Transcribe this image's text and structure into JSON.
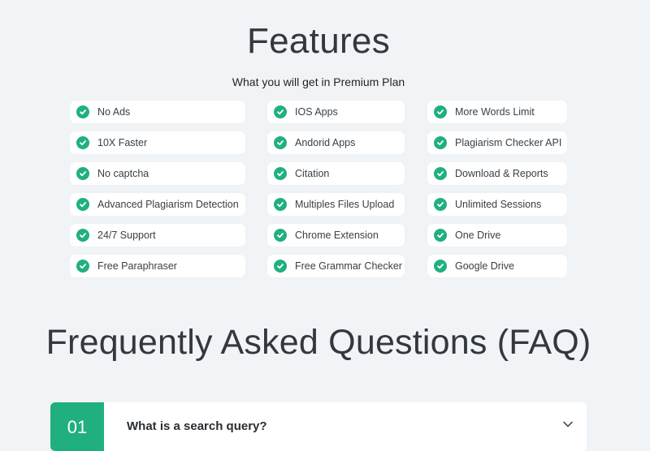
{
  "features": {
    "title": "Features",
    "subtitle": "What you will get in Premium Plan",
    "check_color": "#20b07f",
    "icon": "check-circle-icon",
    "columns": [
      [
        "No Ads",
        "10X Faster",
        "No captcha",
        "Advanced Plagiarism Detection",
        "24/7 Support",
        "Free Paraphraser"
      ],
      [
        "IOS Apps",
        "Andorid Apps",
        "Citation",
        "Multiples Files Upload",
        "Chrome Extension",
        "Free Grammar Checker"
      ],
      [
        "More Words Limit",
        "Plagiarism Checker API",
        "Download & Reports",
        "Unlimited Sessions",
        "One Drive",
        "Google Drive"
      ]
    ]
  },
  "faq": {
    "title": "Frequently Asked Questions (FAQ)",
    "items": [
      {
        "number": "01",
        "question": "What is a search query?",
        "icon": "chevron-down-icon"
      }
    ]
  }
}
